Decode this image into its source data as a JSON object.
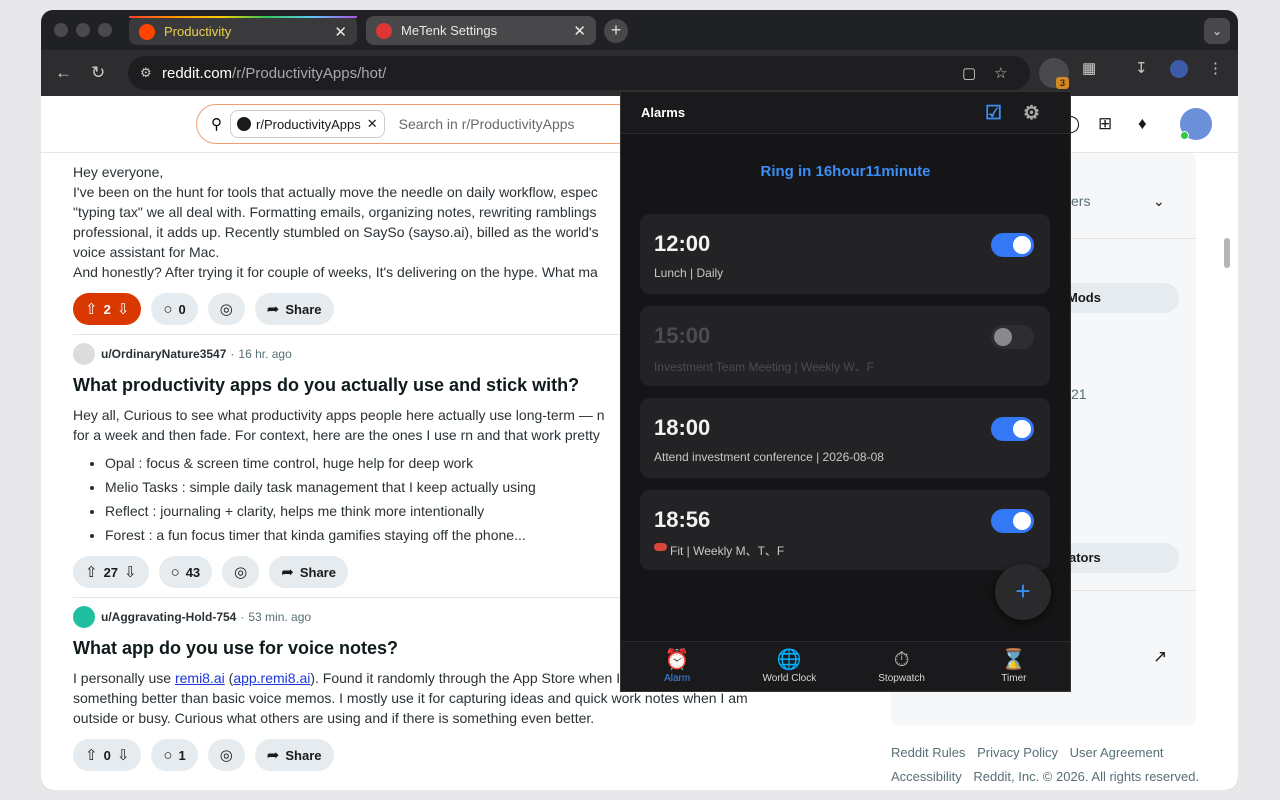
{
  "browser": {
    "tabs": [
      {
        "label": "Productivity",
        "active": true
      },
      {
        "label": "MeTenk Settings",
        "active": false
      }
    ],
    "close_glyph": "✕",
    "new_tab_glyph": "+",
    "tab_menu_glyph": "⌄",
    "url_host": "reddit.com",
    "url_path": "/r/ProductivityApps/hot/",
    "extension_badge": "3"
  },
  "reddit": {
    "search_chip": "r/ProductivityApps",
    "search_placeholder": "Search in r/ProductivityApps",
    "post1": {
      "body": [
        "Hey everyone,",
        "I've been on the hunt for tools that actually move the needle on daily workflow, espec",
        "\"typing tax\" we all deal with. Formatting emails, organizing notes, rewriting ramblings",
        "professional, it adds up. Recently stumbled on SaySo (sayso.ai), billed as the world's",
        "voice assistant for Mac.",
        "And honestly? After trying it for couple of weeks, It's delivering on the hype. What ma"
      ],
      "votes": "2",
      "comments": "0",
      "share": "Share"
    },
    "post2": {
      "user": "u/OrdinaryNature3547",
      "age": "16 hr. ago",
      "title": "What productivity apps do you actually use and stick with?",
      "body": [
        "Hey all, Curious to see what productivity apps people here actually use long-term — n",
        "for a week and then fade. For context, here are the ones I use rn and that work pretty"
      ],
      "bullets": [
        "Opal : focus & screen time control, huge help for deep work",
        "Melio Tasks : simple daily task management that I keep actually using",
        "Reflect : journaling + clarity, helps me think more intentionally",
        "Forest : a fun focus timer that kinda gamifies staying off the phone..."
      ],
      "votes": "27",
      "comments": "43",
      "share": "Share"
    },
    "post3": {
      "user": "u/Aggravating-Hold-754",
      "age": "53 min. ago",
      "title": "What app do you use for voice notes?",
      "body_pre": "I personally use ",
      "link1": "remi8.ai",
      "body_mid": " (",
      "link2": "app.remi8.ai",
      "body_post": "). Found it randomly through the App Store when I was looking for",
      "body_lines": [
        "something better than basic voice memos. I mostly use it for capturing ideas and quick work notes when I am",
        "outside or busy. Curious what others are using and if there is something even better."
      ],
      "votes": "0",
      "comments": "1",
      "share": "Share"
    },
    "sidebar": {
      "peek1": "ers",
      "pill1": "Mods",
      "peek2": "21",
      "pill2": "ators"
    },
    "footer": {
      "links1": [
        "Reddit Rules",
        "Privacy Policy",
        "User Agreement"
      ],
      "accessibility": "Accessibility",
      "copyright": "Reddit, Inc. © 2026. All rights reserved."
    }
  },
  "alarm_app": {
    "title": "Alarms",
    "ring_text": "Ring in 16hour11minute",
    "alarms": [
      {
        "time": "12:00",
        "desc": "Lunch | Daily",
        "enabled": true
      },
      {
        "time": "15:00",
        "desc": "Investment Team Meeting | Weekly W、F",
        "enabled": false
      },
      {
        "time": "18:00",
        "desc": "Attend investment conference | 2026-08-08",
        "enabled": true
      },
      {
        "time": "18:56",
        "desc": "Fit | Weekly M、T、F",
        "enabled": true
      }
    ],
    "fab": "+",
    "nav": [
      {
        "label": "Alarm",
        "icon": "alarm-clock-icon",
        "glyph": "⏰",
        "active": true
      },
      {
        "label": "World Clock",
        "icon": "globe-icon",
        "glyph": "🌐",
        "active": false
      },
      {
        "label": "Stopwatch",
        "icon": "stopwatch-icon",
        "glyph": "⏱",
        "active": false
      },
      {
        "label": "Timer",
        "icon": "hourglass-icon",
        "glyph": "⌛",
        "active": false
      }
    ]
  },
  "colors": {
    "accent_blue": "#3478f6",
    "reddit_orange": "#d93900"
  }
}
